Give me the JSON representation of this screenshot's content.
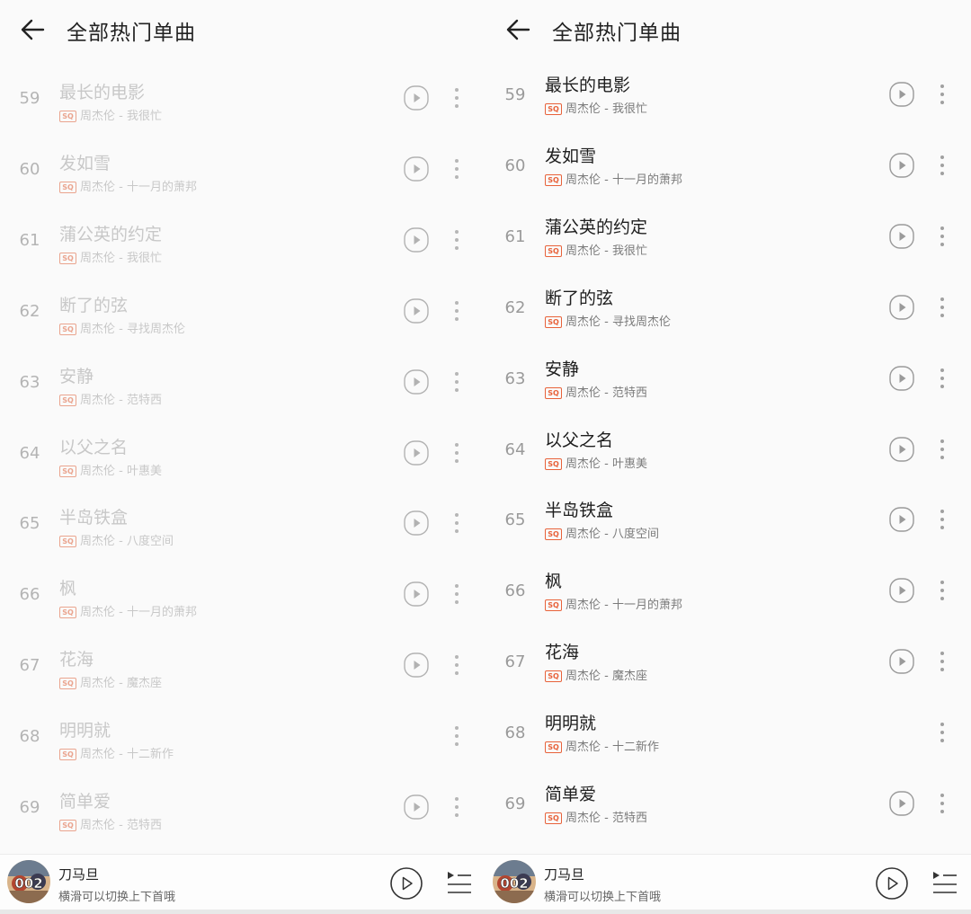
{
  "header": {
    "title": "全部热门单曲"
  },
  "songs": [
    {
      "rank": "59",
      "title": "最长的电影",
      "artist_album": "周杰伦 - 我很忙",
      "playable": true
    },
    {
      "rank": "60",
      "title": "发如雪",
      "artist_album": "周杰伦 - 十一月的萧邦",
      "playable": true
    },
    {
      "rank": "61",
      "title": "蒲公英的约定",
      "artist_album": "周杰伦 - 我很忙",
      "playable": true
    },
    {
      "rank": "62",
      "title": "断了的弦",
      "artist_album": "周杰伦 - 寻找周杰伦",
      "playable": true
    },
    {
      "rank": "63",
      "title": "安静",
      "artist_album": "周杰伦 - 范特西",
      "playable": true
    },
    {
      "rank": "64",
      "title": "以父之名",
      "artist_album": "周杰伦 - 叶惠美",
      "playable": true
    },
    {
      "rank": "65",
      "title": "半岛铁盒",
      "artist_album": "周杰伦 - 八度空间",
      "playable": true
    },
    {
      "rank": "66",
      "title": "枫",
      "artist_album": "周杰伦 - 十一月的萧邦",
      "playable": true
    },
    {
      "rank": "67",
      "title": "花海",
      "artist_album": "周杰伦 - 魔杰座",
      "playable": true
    },
    {
      "rank": "68",
      "title": "明明就",
      "artist_album": "周杰伦 - 十二新作",
      "playable": false
    },
    {
      "rank": "69",
      "title": "简单爱",
      "artist_album": "周杰伦 - 范特西",
      "playable": true
    }
  ],
  "quality_badge": "SQ",
  "player": {
    "now_playing": "刀马旦",
    "hint": "横滑可以切换上下首哦",
    "cover_text": "002"
  },
  "icons": {
    "back": "back-arrow-icon",
    "play": "play-circle-icon",
    "more": "more-vertical-icon",
    "queue": "playlist-queue-icon"
  },
  "colors": {
    "accent": "#e8623a",
    "left_panel_state": "loading/faded",
    "right_panel_state": "normal"
  }
}
